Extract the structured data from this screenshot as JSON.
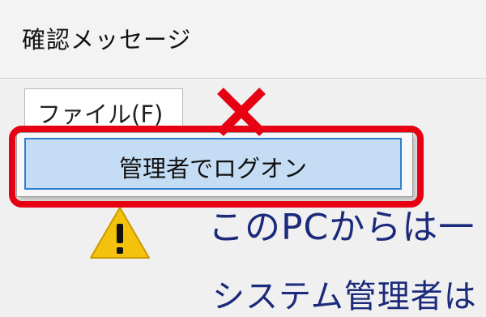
{
  "window": {
    "title": "確認メッセージ"
  },
  "menubar": {
    "file_label": "ファイル(F)"
  },
  "dropdown": {
    "items": [
      {
        "label": "管理者でログオン"
      }
    ]
  },
  "annotation": {
    "highlight_color": "#e60012",
    "cross_color": "#e60012"
  },
  "message": {
    "line1": "このPCからは一",
    "line2": "システム管理者は"
  },
  "colors": {
    "accent": "#2f7fd0",
    "selection": "#c4dcf4",
    "message_text": "#1b2a7a",
    "warning": "#f4c20d"
  }
}
